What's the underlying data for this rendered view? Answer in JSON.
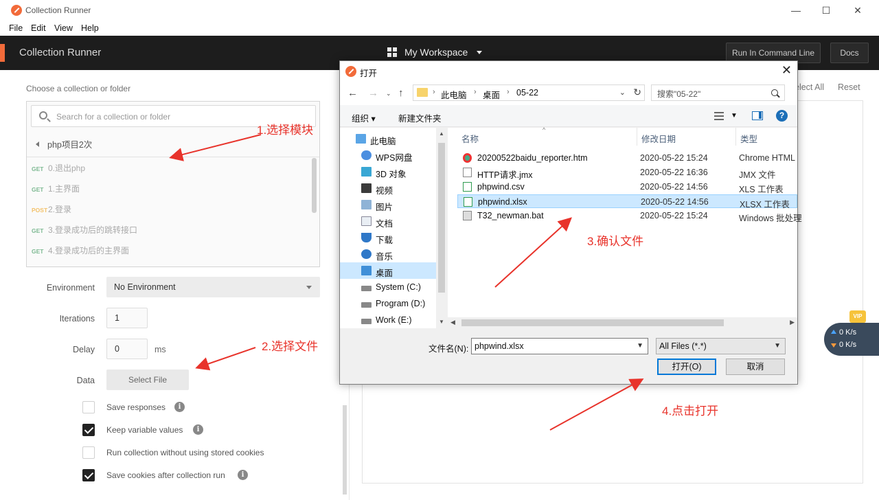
{
  "window": {
    "title": "Collection Runner",
    "controls": {
      "minimize": "—",
      "maximize": "☐",
      "close": "✕"
    }
  },
  "menubar": [
    "File",
    "Edit",
    "View",
    "Help"
  ],
  "header": {
    "title": "Collection Runner",
    "workspace": "My Workspace",
    "run_cli": "Run In Command Line",
    "docs": "Docs"
  },
  "left": {
    "choose_label": "Choose a collection or folder",
    "search_placeholder": "Search for a collection or folder",
    "breadcrumb": "php项目2次",
    "requests": [
      {
        "method": "GET",
        "name": "0.退出php"
      },
      {
        "method": "GET",
        "name": "1.主界面"
      },
      {
        "method": "POST",
        "name": "2.登录"
      },
      {
        "method": "GET",
        "name": "3.登录成功后的跳转接口"
      },
      {
        "method": "GET",
        "name": "4.登录成功后的主界面"
      }
    ],
    "environment_label": "Environment",
    "environment_value": "No Environment",
    "iterations_label": "Iterations",
    "iterations_value": "1",
    "delay_label": "Delay",
    "delay_value": "0",
    "delay_unit": "ms",
    "data_label": "Data",
    "select_file": "Select File",
    "options": [
      {
        "label": "Save responses",
        "checked": false,
        "info": true
      },
      {
        "label": "Keep variable values",
        "checked": true,
        "info": true
      },
      {
        "label": "Run collection without using stored cookies",
        "checked": false,
        "info": false
      },
      {
        "label": "Save cookies after collection run",
        "checked": true,
        "info": true
      }
    ]
  },
  "right": {
    "select_all": "elect All",
    "reset": "Reset"
  },
  "speed": {
    "up": "0 K/s",
    "down": "0 K/s",
    "badge": "VIP"
  },
  "dialog": {
    "title": "打开",
    "close": "✕",
    "path": [
      "此电脑",
      "桌面",
      "05-22"
    ],
    "search_placeholder": "搜索\"05-22\"",
    "organize": "组织 ▾",
    "new_folder": "新建文件夹",
    "help": "?",
    "nav": [
      "此电脑",
      "WPS网盘",
      "3D 对象",
      "视频",
      "图片",
      "文档",
      "下载",
      "音乐",
      "桌面",
      "System (C:)",
      "Program (D:)",
      "Work (E:)"
    ],
    "columns": {
      "name": "名称",
      "date": "修改日期",
      "type": "类型"
    },
    "files": [
      {
        "name": "20200522baidu_reporter.htm",
        "date": "2020-05-22 15:24",
        "type": "Chrome HTML"
      },
      {
        "name": "HTTP请求.jmx",
        "date": "2020-05-22 16:36",
        "type": "JMX 文件"
      },
      {
        "name": "phpwind.csv",
        "date": "2020-05-22 14:56",
        "type": "XLS 工作表"
      },
      {
        "name": "phpwind.xlsx",
        "date": "2020-05-22 14:56",
        "type": "XLSX 工作表"
      },
      {
        "name": "T32_newman.bat",
        "date": "2020-05-22 15:24",
        "type": "Windows 批处理"
      }
    ],
    "filename_label": "文件名(N):",
    "filename_value": "phpwind.xlsx",
    "filetype_value": "All Files (*.*)",
    "open_btn": "打开(O)",
    "cancel_btn": "取消"
  },
  "annotations": {
    "a1": "1.选择模块",
    "a2": "2.选择文件",
    "a3": "3.确认文件",
    "a4": "4.点击打开"
  },
  "colors": {
    "accent": "#f26b3a",
    "annotation": "#e8332b",
    "selection": "#cce8ff"
  }
}
